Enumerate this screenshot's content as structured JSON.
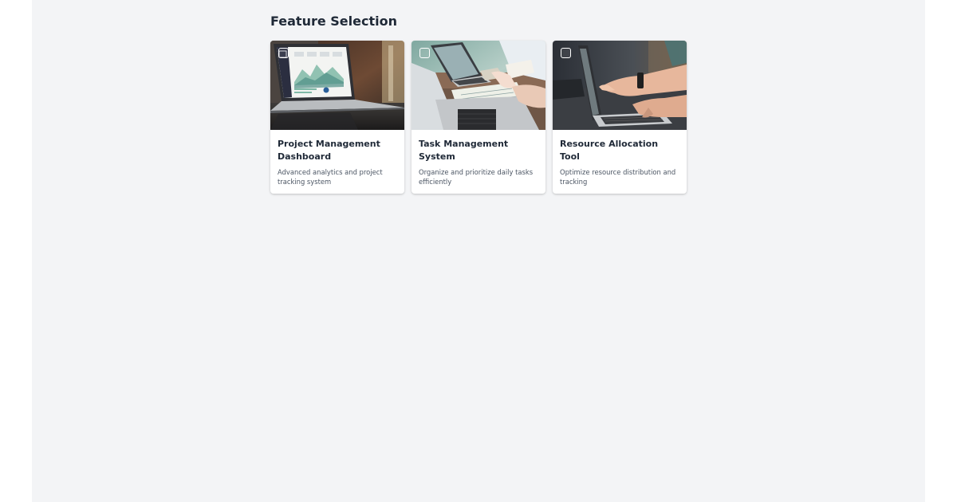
{
  "page": {
    "title": "Feature Selection"
  },
  "features": [
    {
      "title": "Project Management Dashboard",
      "description": "Advanced analytics and project tracking system",
      "selected": false,
      "image": "laptop-analytics-dashboard-photo"
    },
    {
      "title": "Task Management System",
      "description": "Organize and prioritize daily tasks efficiently",
      "selected": false,
      "image": "team-desk-laptops-photo"
    },
    {
      "title": "Resource Allocation Tool",
      "description": "Optimize resource distribution and tracking",
      "selected": false,
      "image": "hand-pointing-laptop-photo"
    }
  ],
  "colors": {
    "background": "#f3f4f6",
    "card": "#ffffff",
    "title_text": "#1f2937",
    "body_text": "#4b5563"
  }
}
